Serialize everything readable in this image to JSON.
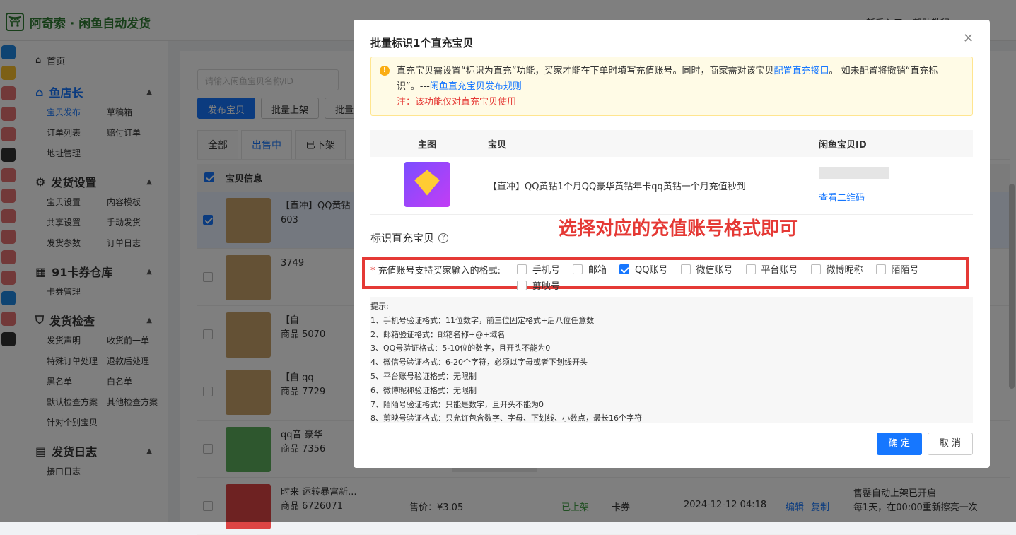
{
  "app": {
    "logo_text": "阿奇索 · 闲鱼自动发货",
    "header_right": [
      "新手入口",
      "帮助教程"
    ]
  },
  "sidebar": {
    "home": "首页",
    "sections": [
      {
        "title": "鱼店长",
        "items": [
          "宝贝发布",
          "草稿箱",
          "订单列表",
          "赔付订单",
          "地址管理"
        ]
      },
      {
        "title": "发货设置",
        "items": [
          "宝贝设置",
          "内容模板",
          "共享设置",
          "手动发货",
          "发货参数",
          "订单日志"
        ]
      },
      {
        "title": "91卡券仓库",
        "items": [
          "卡券管理"
        ]
      },
      {
        "title": "发货检查",
        "items": [
          "发货声明",
          "收货前一单",
          "特殊订单处理",
          "退款后处理",
          "黑名单",
          "白名单",
          "默认检查方案",
          "其他检查方案",
          "针对个别宝贝"
        ]
      },
      {
        "title": "发货日志",
        "items": [
          "接口日志"
        ]
      }
    ]
  },
  "main": {
    "search_placeholder": "请输入闲鱼宝贝名称/ID",
    "buttons": [
      "发布宝贝",
      "批量上架",
      "批量"
    ],
    "tabs": [
      "全部",
      "出售中",
      "已下架"
    ],
    "table_header": "宝贝信息",
    "rows": [
      {
        "title": "【直冲】QQ黄钻",
        "sub": "603",
        "selected": true
      },
      {
        "title": "",
        "sub": "3749",
        "selected": false
      },
      {
        "title": "【自",
        "sub": "商品 5070",
        "selected": false
      },
      {
        "title": "【自 qq",
        "sub": "商品 7729",
        "selected": false
      },
      {
        "title": "qq音 豪华",
        "sub": "商品 7356",
        "selected": false
      },
      {
        "title": "时来 运转暴富新...",
        "sub": "商品 6726071",
        "price": "售价：¥3.05",
        "status": "已上架",
        "type": "卡券",
        "date": "2024-12-12 04:18",
        "actions": [
          "编辑",
          "复制"
        ],
        "note": [
          "售罄自动上架已开启",
          "每1天，在00:00重新擦亮一次"
        ],
        "selected": false
      }
    ]
  },
  "modal": {
    "title": "批量标识1个直充宝贝",
    "alert": {
      "text1": "直充宝贝需设置“标识为直充”功能，买家才能在下单时填写充值账号。同时，商家需对该宝贝",
      "link1": "配置直充接口",
      "text2": "。 如未配置将撤销“直充标识”。---",
      "link2": "闲鱼直充宝贝发布规则",
      "warn": "注：该功能仅对直充宝贝使用"
    },
    "table": {
      "headers": [
        "主图",
        "宝贝",
        "闲鱼宝贝ID"
      ],
      "item": {
        "title": "【直冲】QQ黄钻1个月QQ豪华黄钻年卡qq黄钻一个月充值秒到",
        "link": "查看二维码"
      }
    },
    "annotation": "选择对应的充值账号格式即可",
    "mark_label": "标识直充宝贝",
    "format_label": "充值账号支持买家输入的格式:",
    "options": [
      {
        "label": "手机号",
        "checked": false
      },
      {
        "label": "邮箱",
        "checked": false
      },
      {
        "label": "QQ账号",
        "checked": true
      },
      {
        "label": "微信账号",
        "checked": false
      },
      {
        "label": "平台账号",
        "checked": false
      },
      {
        "label": "微博昵称",
        "checked": false
      },
      {
        "label": "陌陌号",
        "checked": false
      },
      {
        "label": "剪映号",
        "checked": false
      }
    ],
    "tips": [
      "提示:",
      "1、手机号验证格式：11位数字，前三位固定格式+后八位任意数",
      "2、邮箱验证格式：邮箱名称+@+域名",
      "3、QQ号验证格式：5-10位的数字，且开头不能为0",
      "4、微信号验证格式：6-20个字符，必须以字母或者下划线开头",
      "5、平台账号验证格式：无限制",
      "6、微博昵称验证格式：无限制",
      "7、陌陌号验证格式：只能是数字，且开头不能为0",
      "8、剪映号验证格式：只允许包含数字、字母、下划线、小数点，最长16个字符"
    ],
    "confirm": "确 定",
    "cancel": "取 消"
  }
}
